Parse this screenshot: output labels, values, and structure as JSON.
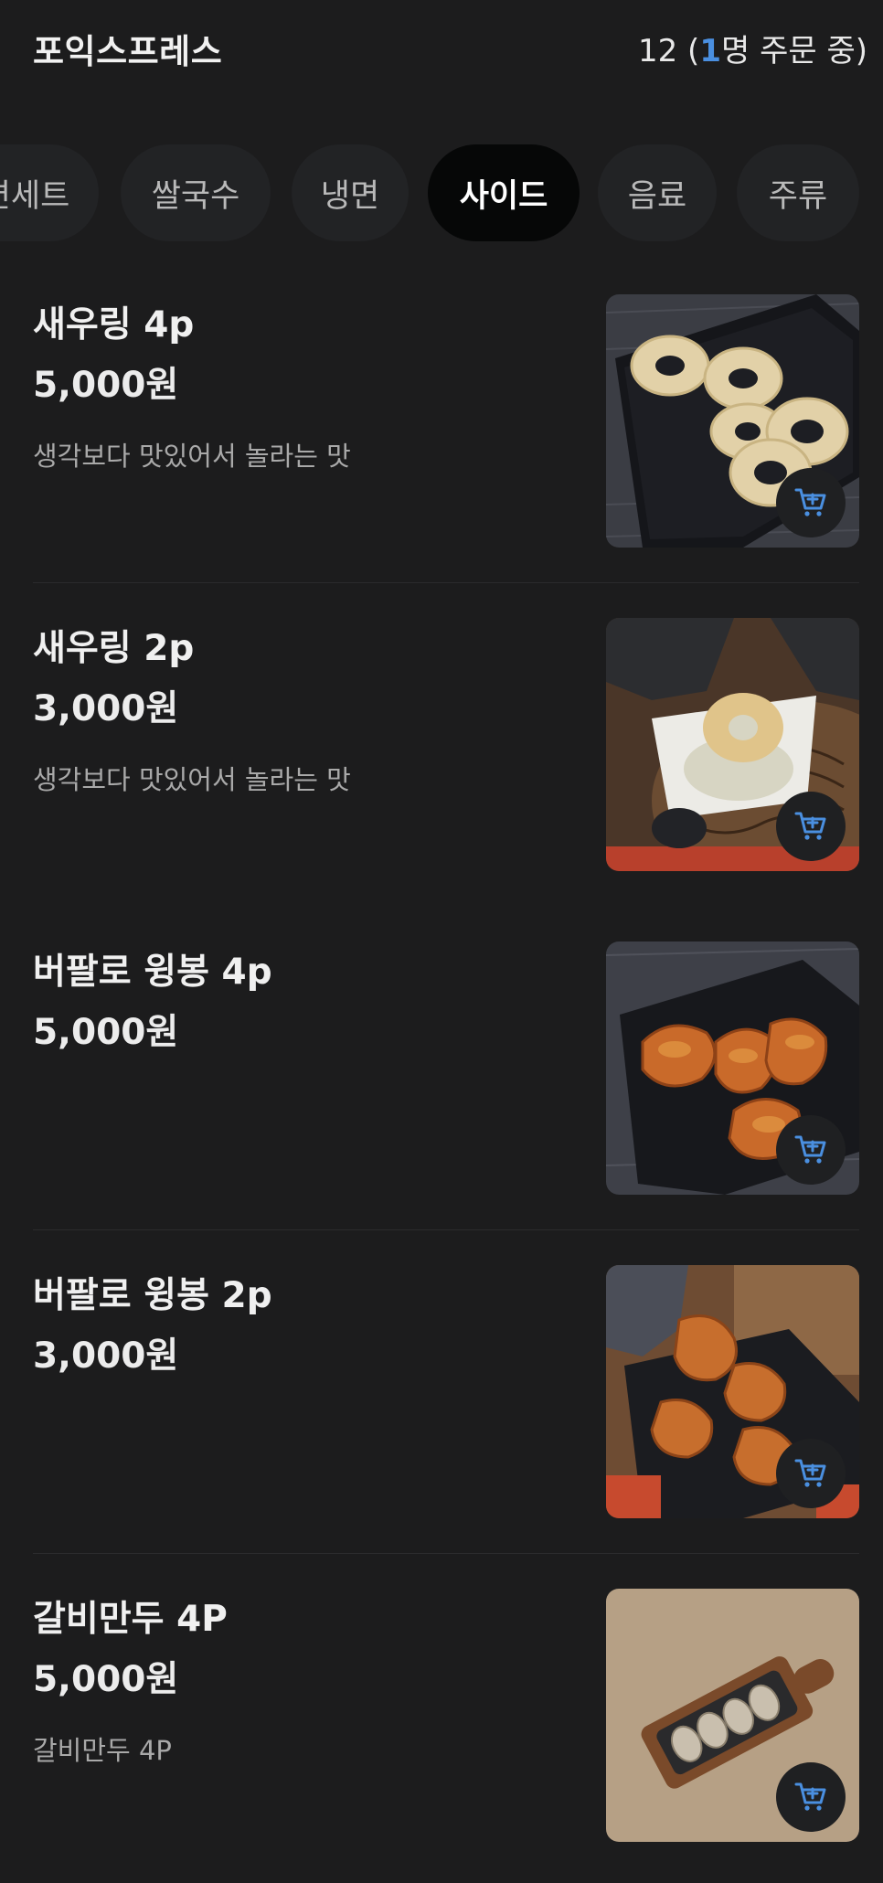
{
  "header": {
    "store_name": "포익스프레스",
    "table_number": "12",
    "paren_open": " (",
    "ordering_count": "1",
    "ordering_suffix": "명 주문 중)"
  },
  "tabs": [
    {
      "label": "면세트",
      "active": false
    },
    {
      "label": "쌀국수",
      "active": false
    },
    {
      "label": "냉면",
      "active": false
    },
    {
      "label": "사이드",
      "active": true
    },
    {
      "label": "음료",
      "active": false
    },
    {
      "label": "주류",
      "active": false
    }
  ],
  "items": [
    {
      "name": "새우링 4p",
      "price": "5,000원",
      "description": "생각보다 맛있어서 놀라는 맛",
      "image": "shrimp-rings-4p-photo"
    },
    {
      "name": "새우링 2p",
      "price": "3,000원",
      "description": "생각보다 맛있어서 놀라는 맛",
      "image": "shrimp-ring-dip-photo"
    },
    {
      "name": "버팔로 윙봉 4p",
      "price": "5,000원",
      "description": "",
      "image": "buffalo-wings-4p-photo"
    },
    {
      "name": "버팔로 윙봉 2p",
      "price": "3,000원",
      "description": "",
      "image": "buffalo-wings-2p-photo"
    },
    {
      "name": "갈비만두 4P",
      "price": "5,000원",
      "description": "갈비만두 4P",
      "image": "galbi-dumplings-photo"
    }
  ],
  "icons": {
    "cart": "add-to-cart-icon"
  },
  "colors": {
    "background": "#1c1c1d",
    "accent": "#4a8fe0",
    "active_tab": "#060707"
  }
}
